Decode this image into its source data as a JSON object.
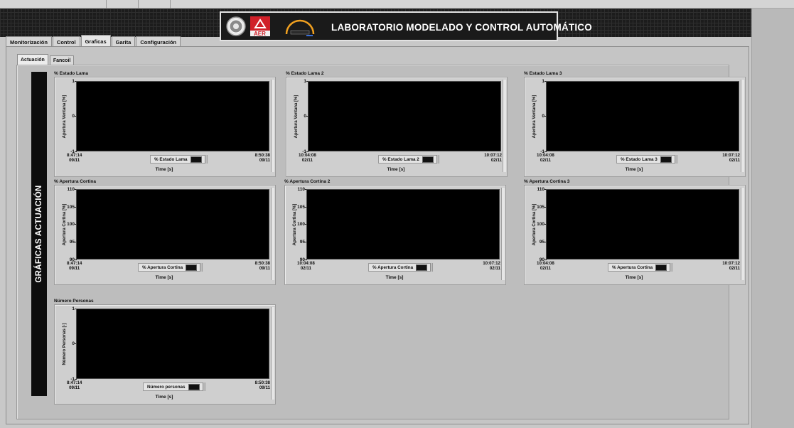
{
  "header": {
    "title": "LABORATORIO MODELADO Y CONTROL AUTOMÁTICO",
    "logo_text": "AER"
  },
  "tabs": [
    {
      "label": "Monitorización",
      "active": false
    },
    {
      "label": "Control",
      "active": false
    },
    {
      "label": "Graficas",
      "active": true
    },
    {
      "label": "Garita",
      "active": false
    },
    {
      "label": "Configuración",
      "active": false
    }
  ],
  "subtabs": [
    {
      "label": "Actuación",
      "active": true
    },
    {
      "label": "Fancoil",
      "active": false
    }
  ],
  "side_banner": "GRÁFICAS ACTUACIÓN",
  "charts": [
    {
      "title": "% Estado Lama",
      "ylabel": "Apertura Ventana [%]",
      "yticks": [
        "1",
        "0",
        "-1"
      ],
      "x_start_time": "8:47:14",
      "x_start_date": "09/11",
      "x_end_time": "8:50:38",
      "x_end_date": "09/11",
      "legend": "% Estado Lama",
      "xlabel": "Time [s]"
    },
    {
      "title": "% Estado Lama 2",
      "ylabel": "Apertura Ventana [%]",
      "yticks": [
        "1",
        "0",
        "-1"
      ],
      "x_start_time": "10:04:08",
      "x_start_date": "02/11",
      "x_end_time": "10:07:12",
      "x_end_date": "02/11",
      "legend": "% Estado Lama 2",
      "xlabel": "Time [s]"
    },
    {
      "title": "% Estado Lama 3",
      "ylabel": "Apertura Ventana [%]",
      "yticks": [
        "1",
        "0",
        "-1"
      ],
      "x_start_time": "10:04:08",
      "x_start_date": "02/11",
      "x_end_time": "10:07:12",
      "x_end_date": "02/11",
      "legend": "% Estado Lama 3",
      "xlabel": "Time [s]"
    },
    {
      "title": "% Apertura Cortina",
      "ylabel": "Apertura Cortina [%]",
      "yticks": [
        "110",
        "105",
        "100",
        "95",
        "90"
      ],
      "x_start_time": "8:47:14",
      "x_start_date": "09/11",
      "x_end_time": "8:50:38",
      "x_end_date": "09/11",
      "legend": "% Apertura Cortina",
      "xlabel": "Time [s]"
    },
    {
      "title": "% Apertura Cortina 2",
      "ylabel": "Apertura Cortina [%]",
      "yticks": [
        "110",
        "105",
        "100",
        "95",
        "90"
      ],
      "x_start_time": "10:04:08",
      "x_start_date": "02/11",
      "x_end_time": "10:07:12",
      "x_end_date": "02/11",
      "legend": "% Apertura Cortina",
      "xlabel": "Time [s]"
    },
    {
      "title": "% Apertura Cortina 3",
      "ylabel": "Apertura Cortina [%]",
      "yticks": [
        "110",
        "105",
        "100",
        "95",
        "90"
      ],
      "x_start_time": "10:04:08",
      "x_start_date": "02/11",
      "x_end_time": "10:07:12",
      "x_end_date": "02/11",
      "legend": "% Apertura Cortina",
      "xlabel": "Time [s]"
    },
    {
      "title": "Número Personas",
      "ylabel": "Número Personas [-]",
      "yticks": [
        "1",
        "0",
        "-1"
      ],
      "x_start_time": "8:47:14",
      "x_start_date": "09/11",
      "x_end_time": "8:50:38",
      "x_end_date": "09/11",
      "legend": "Número personas",
      "xlabel": "Time [s]"
    }
  ]
}
